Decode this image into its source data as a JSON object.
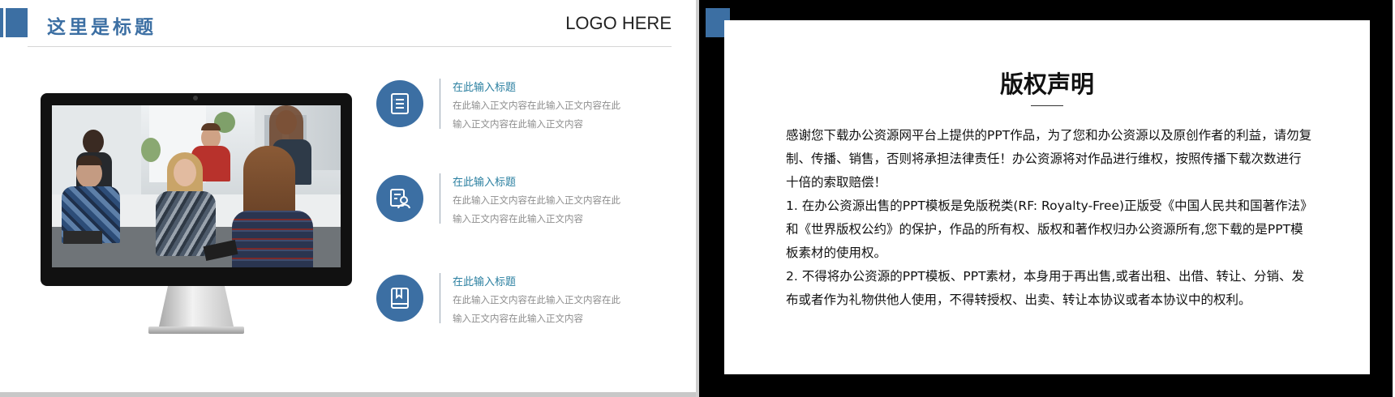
{
  "left_slide": {
    "title": "这里是标题",
    "logo": "LOGO HERE",
    "features": [
      {
        "icon": "list-document-icon",
        "title": "在此输入标题",
        "body": "在此输入正文内容在此输入正文内容在此输入正文内容在此输入正文内容"
      },
      {
        "icon": "person-search-icon",
        "title": "在此输入标题",
        "body": "在此输入正文内容在此输入正文内容在此输入正文内容在此输入正文内容"
      },
      {
        "icon": "bookmark-book-icon",
        "title": "在此输入标题",
        "body": "在此输入正文内容在此输入正文内容在此输入正文内容在此输入正文内容"
      }
    ]
  },
  "right_slide": {
    "title": "版权声明",
    "paragraphs": [
      "感谢您下载办公资源网平台上提供的PPT作品，为了您和办公资源以及原创作者的利益，请勿复制、传播、销售，否则将承担法律责任！办公资源将对作品进行维权，按照传播下载次数进行十倍的索取赔偿！",
      "  1. 在办公资源出售的PPT模板是免版税类(RF: Royalty-Free)正版受《中国人民共和国著作法》和《世界版权公约》的保护，作品的所有权、版权和著作权归办公资源所有,您下载的是PPT模板素材的使用权。",
      "  2. 不得将办公资源的PPT模板、PPT素材，本身用于再出售,或者出租、出借、转让、分销、发布或者作为礼物供他人使用，不得转授权、出卖、转让本协议或者本协议中的权利。"
    ]
  },
  "colors": {
    "accent": "#3c6fa3",
    "feature_title": "#2a7fa0",
    "body_text": "#8e8e8e"
  }
}
